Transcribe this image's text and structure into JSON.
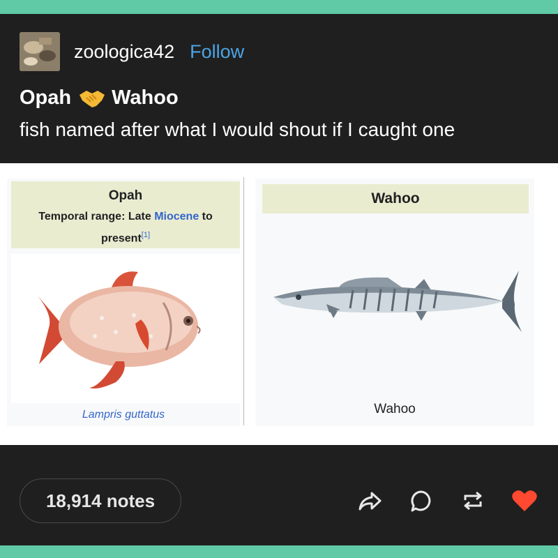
{
  "post": {
    "username": "zoologica42",
    "follow_label": "Follow",
    "title_left": "Opah",
    "title_right": "Wahoo",
    "subtitle": "fish named after what I would shout if I caught one"
  },
  "infobox_left": {
    "name": "Opah",
    "range_prefix": "Temporal range: Late ",
    "range_link": "Miocene",
    "range_suffix": " to present",
    "citation": "[1]",
    "caption": "Lampris guttatus"
  },
  "infobox_right": {
    "name": "Wahoo",
    "caption": "Wahoo"
  },
  "footer": {
    "notes": "18,914 notes"
  },
  "colors": {
    "brand_teal": "#5fcaa5",
    "post_bg": "#1f1f1f",
    "follow_blue": "#4ba4e6",
    "heart_red": "#ff4930",
    "link_blue": "#3366cc"
  },
  "icons": [
    "handshake-icon",
    "share-icon",
    "reply-icon",
    "reblog-icon",
    "like-heart-icon"
  ]
}
